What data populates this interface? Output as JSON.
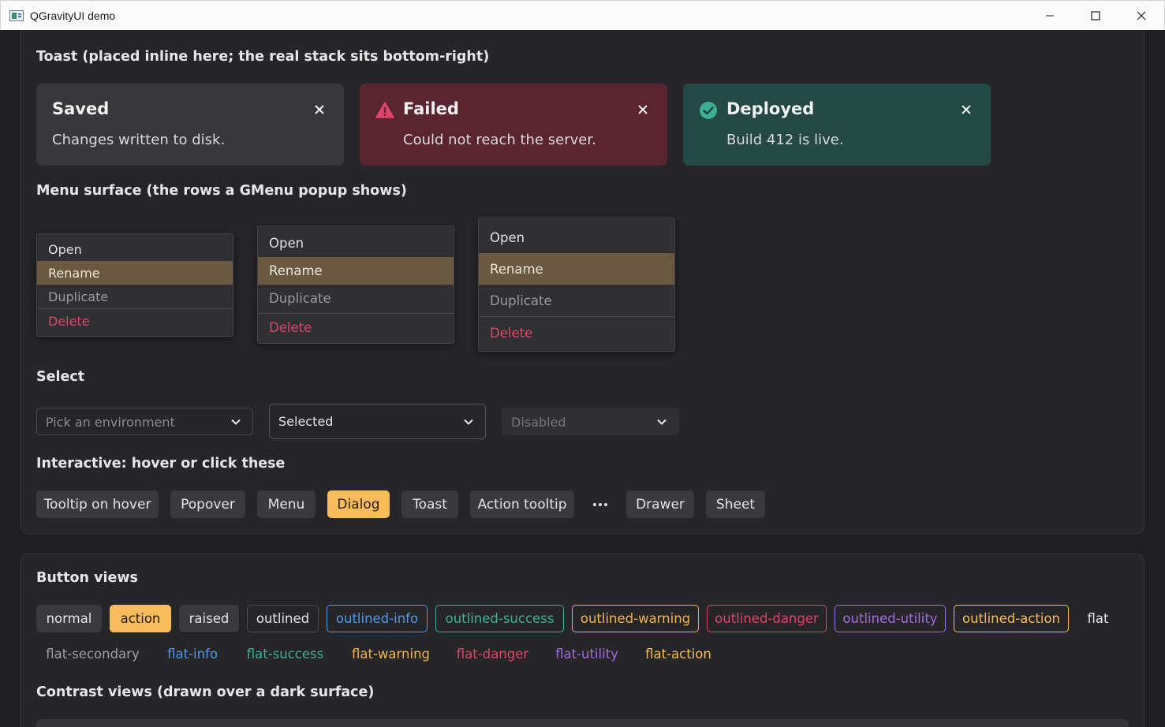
{
  "window": {
    "title": "QGravityUI demo"
  },
  "toast_section": {
    "heading": "Toast (placed inline here; the real stack sits bottom-right)",
    "toasts": [
      {
        "title": "Saved",
        "body": "Changes written to disk.",
        "variant": "neutral",
        "icon": "none"
      },
      {
        "title": "Failed",
        "body": "Could not reach the server.",
        "variant": "danger",
        "icon": "warning-triangle-icon"
      },
      {
        "title": "Deployed",
        "body": "Build 412 is live.",
        "variant": "success",
        "icon": "check-circle-icon"
      }
    ]
  },
  "menu_section": {
    "heading": "Menu surface (the rows a GMenu popup shows)",
    "menus": [
      {
        "size": "small",
        "items": [
          "Open",
          "Rename",
          "Duplicate",
          "Delete"
        ]
      },
      {
        "size": "medium",
        "items": [
          "Open",
          "Rename",
          "Duplicate",
          "Delete"
        ]
      },
      {
        "size": "large",
        "items": [
          "Open",
          "Rename",
          "Duplicate",
          "Delete"
        ]
      }
    ]
  },
  "select_section": {
    "heading": "Select",
    "selects": [
      {
        "text": "Pick an environment",
        "state": "placeholder"
      },
      {
        "text": "Selected",
        "state": "selected"
      },
      {
        "text": "Disabled",
        "state": "disabled"
      }
    ]
  },
  "interactive_section": {
    "heading": "Interactive: hover or click these",
    "buttons": [
      "Tooltip on hover",
      "Popover",
      "Menu",
      "Dialog",
      "Toast",
      "Action tooltip",
      "Drawer",
      "Sheet"
    ],
    "more_icon": "more-horizontal-icon"
  },
  "button_views": {
    "heading": "Button views",
    "row1": [
      "normal",
      "action",
      "raised",
      "outlined",
      "outlined-info",
      "outlined-success",
      "outlined-warning",
      "outlined-danger",
      "outlined-utility",
      "outlined-action",
      "flat"
    ],
    "row2": [
      "flat-secondary",
      "flat-info",
      "flat-success",
      "flat-warning",
      "flat-danger",
      "flat-utility",
      "flat-action"
    ]
  },
  "contrast_views": {
    "heading": "Contrast views (drawn over a dark surface)"
  },
  "colors": {
    "info": "#4f98ea",
    "success": "#3fae96",
    "warning": "#f0b552",
    "danger": "#e0446a",
    "utility": "#a46be0",
    "action": "#f6bc5a",
    "secondary": "#a0a0a4"
  }
}
